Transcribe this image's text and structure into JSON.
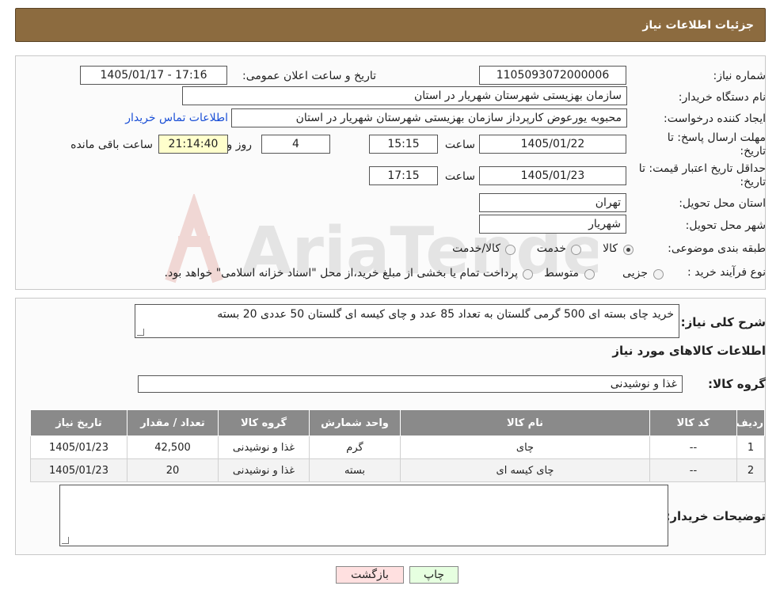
{
  "header": {
    "title": "جزئیات اطلاعات نیاز"
  },
  "form": {
    "need_number_label": "شماره نیاز:",
    "need_number": "1105093072000006",
    "announce_label": "تاریخ و ساعت اعلان عمومی:",
    "announce_value": "1405/01/17 - 17:16",
    "buyer_org_label": "نام دستگاه خریدار:",
    "buyer_org": "سازمان بهزیستی شهرستان شهریار در استان",
    "creator_label": "ایجاد کننده درخواست:",
    "creator": "محبوبه یورعوض کارپرداز سازمان بهزیستی شهرستان شهریار در استان",
    "contact_link": "اطلاعات تماس خریدار",
    "reply_deadline_label": "مهلت ارسال پاسخ: تا تاریخ:",
    "reply_date": "1405/01/22",
    "time_label": "ساعت",
    "reply_time": "15:15",
    "days_value": "4",
    "days_label": "روز و",
    "remaining_time": "21:14:40",
    "remaining_label": "ساعت باقی مانده",
    "price_validity_label": "حداقل تاریخ اعتبار قیمت: تا تاریخ:",
    "price_date": "1405/01/23",
    "price_time": "17:15",
    "province_label": "استان محل تحویل:",
    "province": "تهران",
    "city_label": "شهر محل تحویل:",
    "city": "شهریار",
    "category_label": "طبقه بندی موضوعی:",
    "category_options": [
      "کالا",
      "خدمت",
      "کالا/خدمت"
    ],
    "category_selected": "کالا",
    "process_label": "نوع فرآیند خرید :",
    "process_options": [
      "جزیی",
      "متوسط"
    ],
    "process_note": "پرداخت تمام یا بخشی از مبلغ خرید،از محل \"اسناد خزانه اسلامی\" خواهد بود."
  },
  "summary": {
    "label": "شرح کلی نیاز:",
    "text": "خرید چای بسته ای 500 گرمی گلستان به تعداد 85 عدد و چای کیسه ای گلستان 50 عددی 20 بسته",
    "goods_info_title": "اطلاعات کالاهای مورد نیاز",
    "goods_group_label": "گروه کالا:",
    "goods_group": "غذا و نوشیدنی"
  },
  "table": {
    "headers": [
      "ردیف",
      "کد کالا",
      "نام کالا",
      "واحد شمارش",
      "گروه کالا",
      "تعداد / مقدار",
      "تاریخ نیاز"
    ],
    "rows": [
      [
        "1",
        "--",
        "چای",
        "گرم",
        "غذا و نوشیدنی",
        "42,500",
        "1405/01/23"
      ],
      [
        "2",
        "--",
        "چای کیسه ای",
        "بسته",
        "غذا و نوشیدنی",
        "20",
        "1405/01/23"
      ]
    ]
  },
  "notes": {
    "label": "توضیحات خریدار:",
    "value": ""
  },
  "buttons": {
    "print": "چاپ",
    "back": "بازگشت"
  },
  "watermark": {
    "text": "AriaTender.neT"
  },
  "colors": {
    "header_bg": "#8c6b3f",
    "link": "#1a4fd6",
    "table_header": "#8a8a8a",
    "back_button": "#ffe0e0",
    "print_button": "#e6ffe0",
    "remaining_bg": "#ffffcc"
  }
}
